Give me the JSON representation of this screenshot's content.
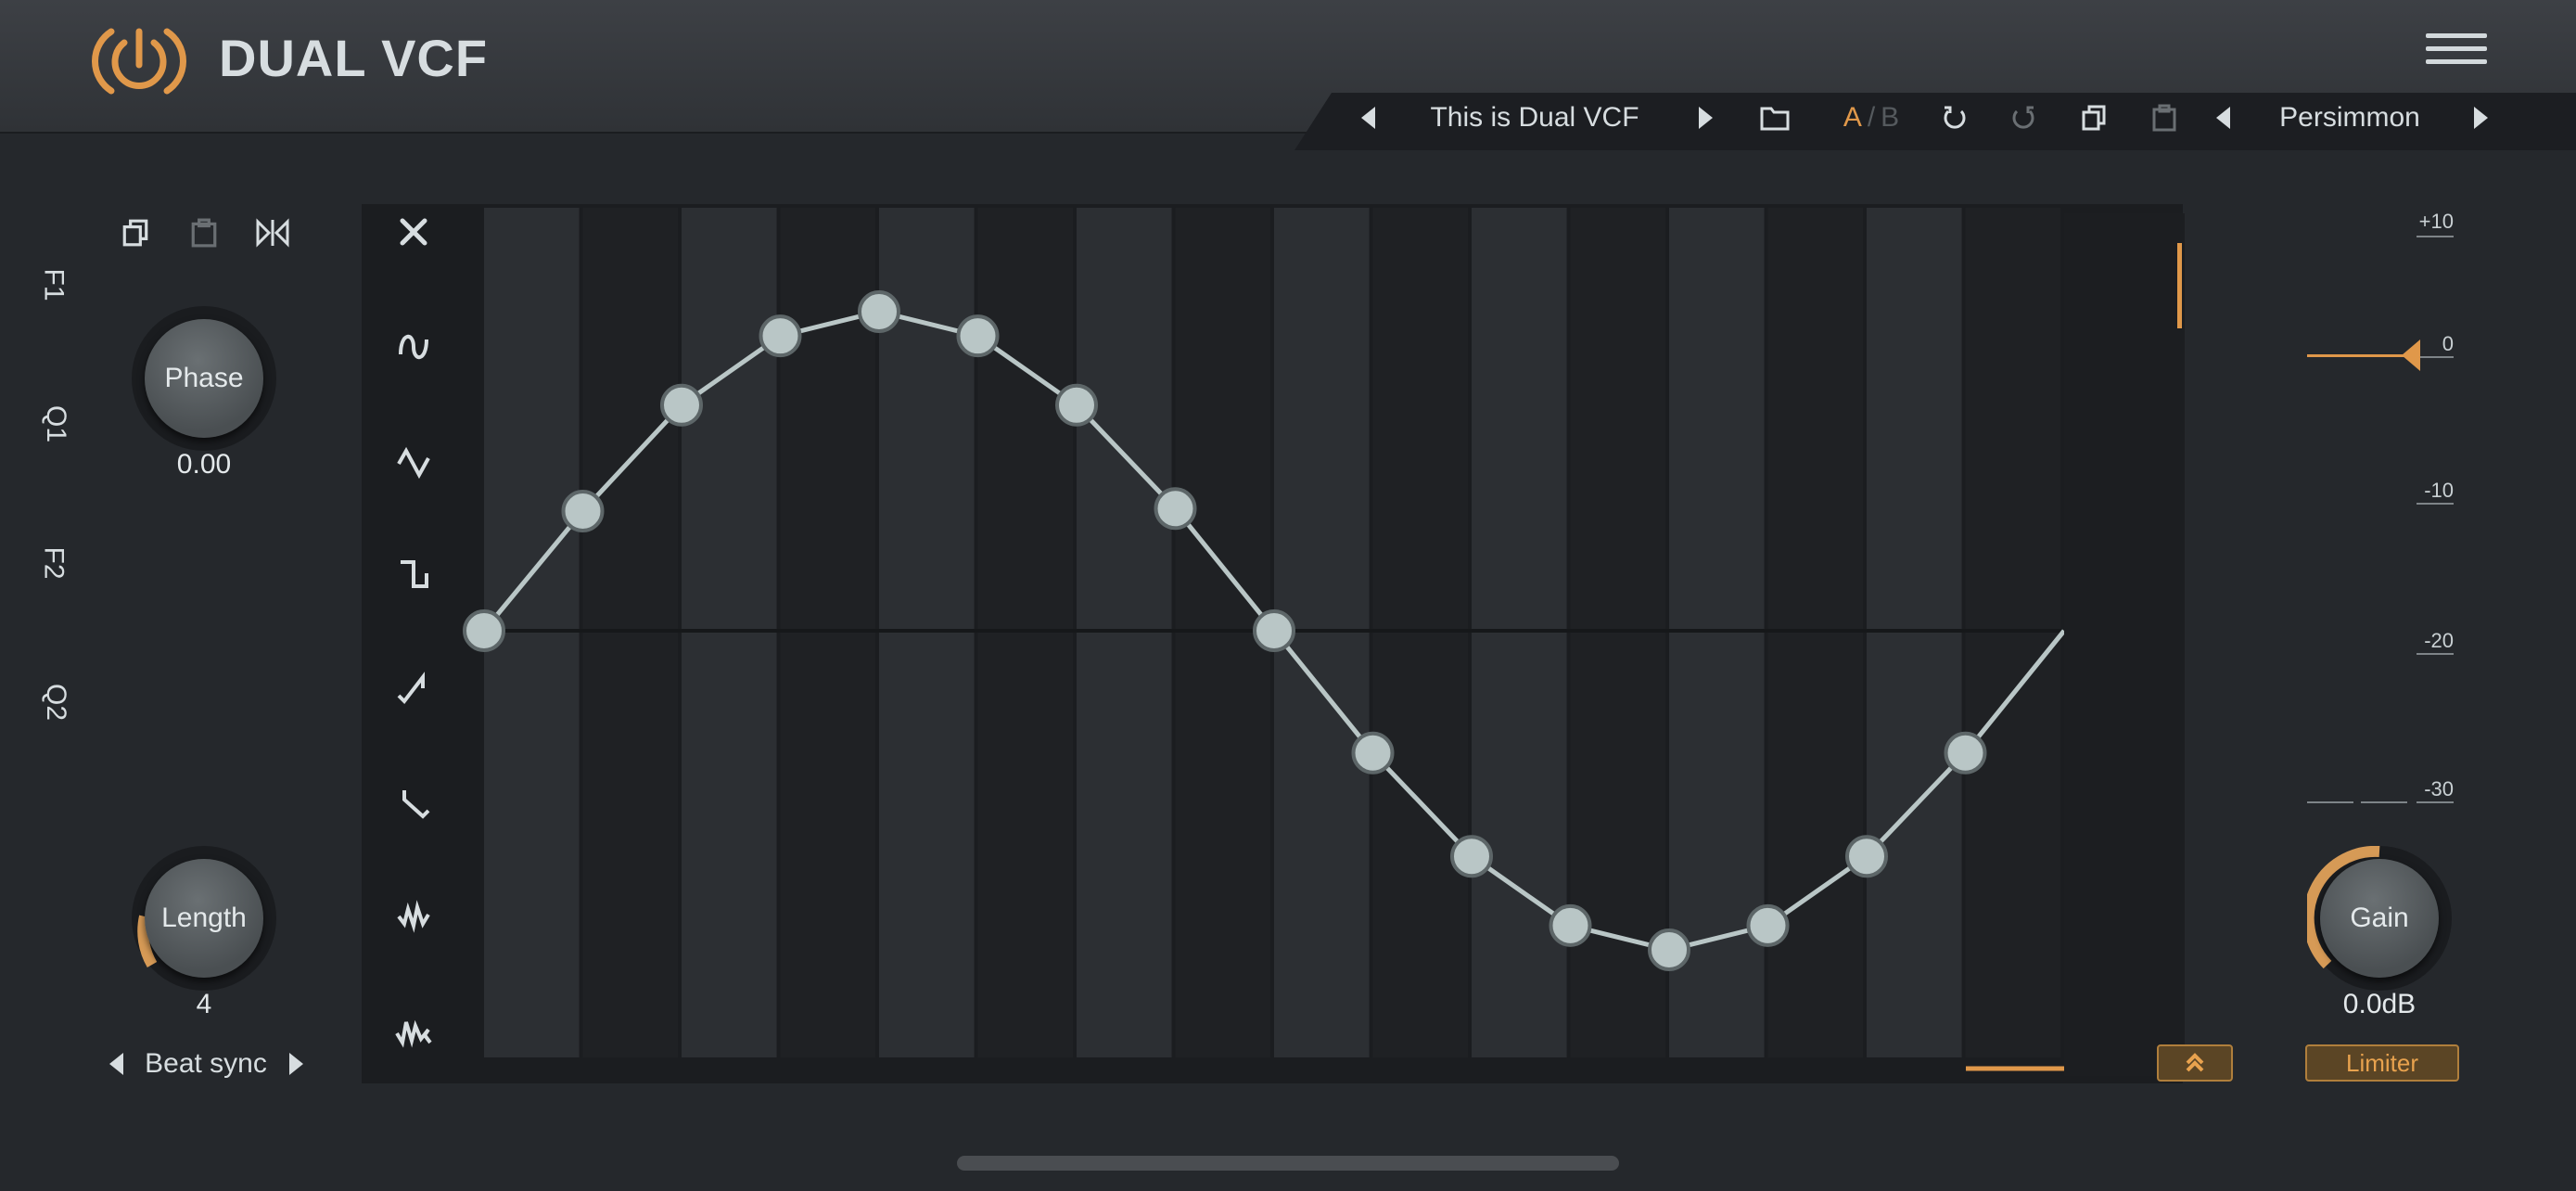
{
  "app": {
    "title": "DUAL VCF"
  },
  "toolbar": {
    "preset_name": "This is Dual VCF",
    "ab_a": "A",
    "ab_sep": "/",
    "ab_b": "B",
    "skin_name": "Persimmon"
  },
  "left": {
    "phase_label": "Phase",
    "phase_value": "0.00",
    "length_label": "Length",
    "length_value": "4",
    "sync_label": "Beat sync"
  },
  "graph": {
    "shapes": [
      "clear",
      "sine",
      "triangle",
      "square",
      "saw-up",
      "saw-down",
      "random-steps",
      "random-smooth"
    ],
    "side_tabs": [
      "F1",
      "Q1",
      "F2",
      "Q2"
    ],
    "active_tab": "F1",
    "columns": 16,
    "points": [
      0,
      0.375,
      0.707,
      0.924,
      1.0,
      0.924,
      0.707,
      0.383,
      0,
      -0.383,
      -0.707,
      -0.924,
      -1.0,
      -0.924,
      -0.707,
      -0.383,
      0
    ]
  },
  "right": {
    "scale": [
      "+10",
      "0",
      "-10",
      "-20",
      "-30"
    ],
    "gain_label": "Gain",
    "gain_value": "0.0dB",
    "limiter_label": "Limiter"
  },
  "colors": {
    "accent": "#e0984a",
    "bg": "#25282c",
    "grid_dark": "#1f2124",
    "grid_light": "#2c2f33",
    "point": "#b9c6c6"
  }
}
